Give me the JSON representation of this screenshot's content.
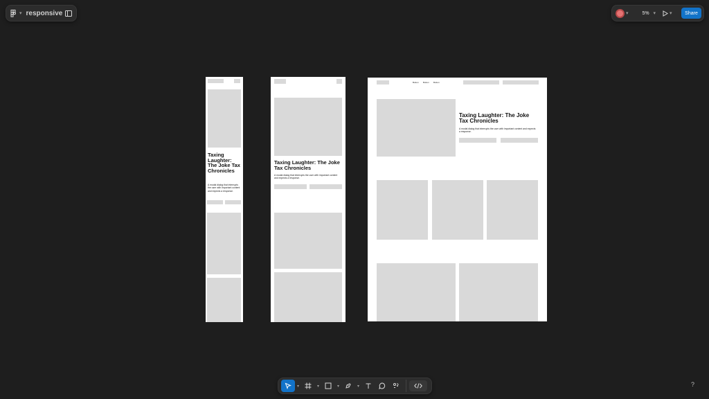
{
  "app": {
    "file_name": "responsive",
    "zoom": "5%",
    "share_label": "Share",
    "help_label": "?",
    "avatar_color": "#e57373",
    "accent_color": "#1273c9"
  },
  "design": {
    "hero_title_mobile": "Taxing Laughter: The Joke Tax Chronicles",
    "hero_title_tablet": "Taxing Laughter: The Joke Tax Chronicles",
    "hero_title_desktop": "Taxing Laughter: The Joke Tax Chronicles",
    "hero_desc_mobile": "A modal dialog that interrupts the user with important content and expects a response.",
    "hero_desc_tablet": "A modal dialog that interrupts the user with important content and expects a response.",
    "hero_desc_desktop": "A modal dialog that interrupts the user with important content and expects a response.",
    "nav_links": [
      "Button",
      "Button",
      "Button"
    ]
  },
  "toolbar": {
    "tools": [
      "move-tool",
      "frame-tool",
      "shape-tool",
      "pen-tool",
      "text-tool",
      "comment-tool",
      "actions-tool",
      "dev-mode"
    ]
  }
}
